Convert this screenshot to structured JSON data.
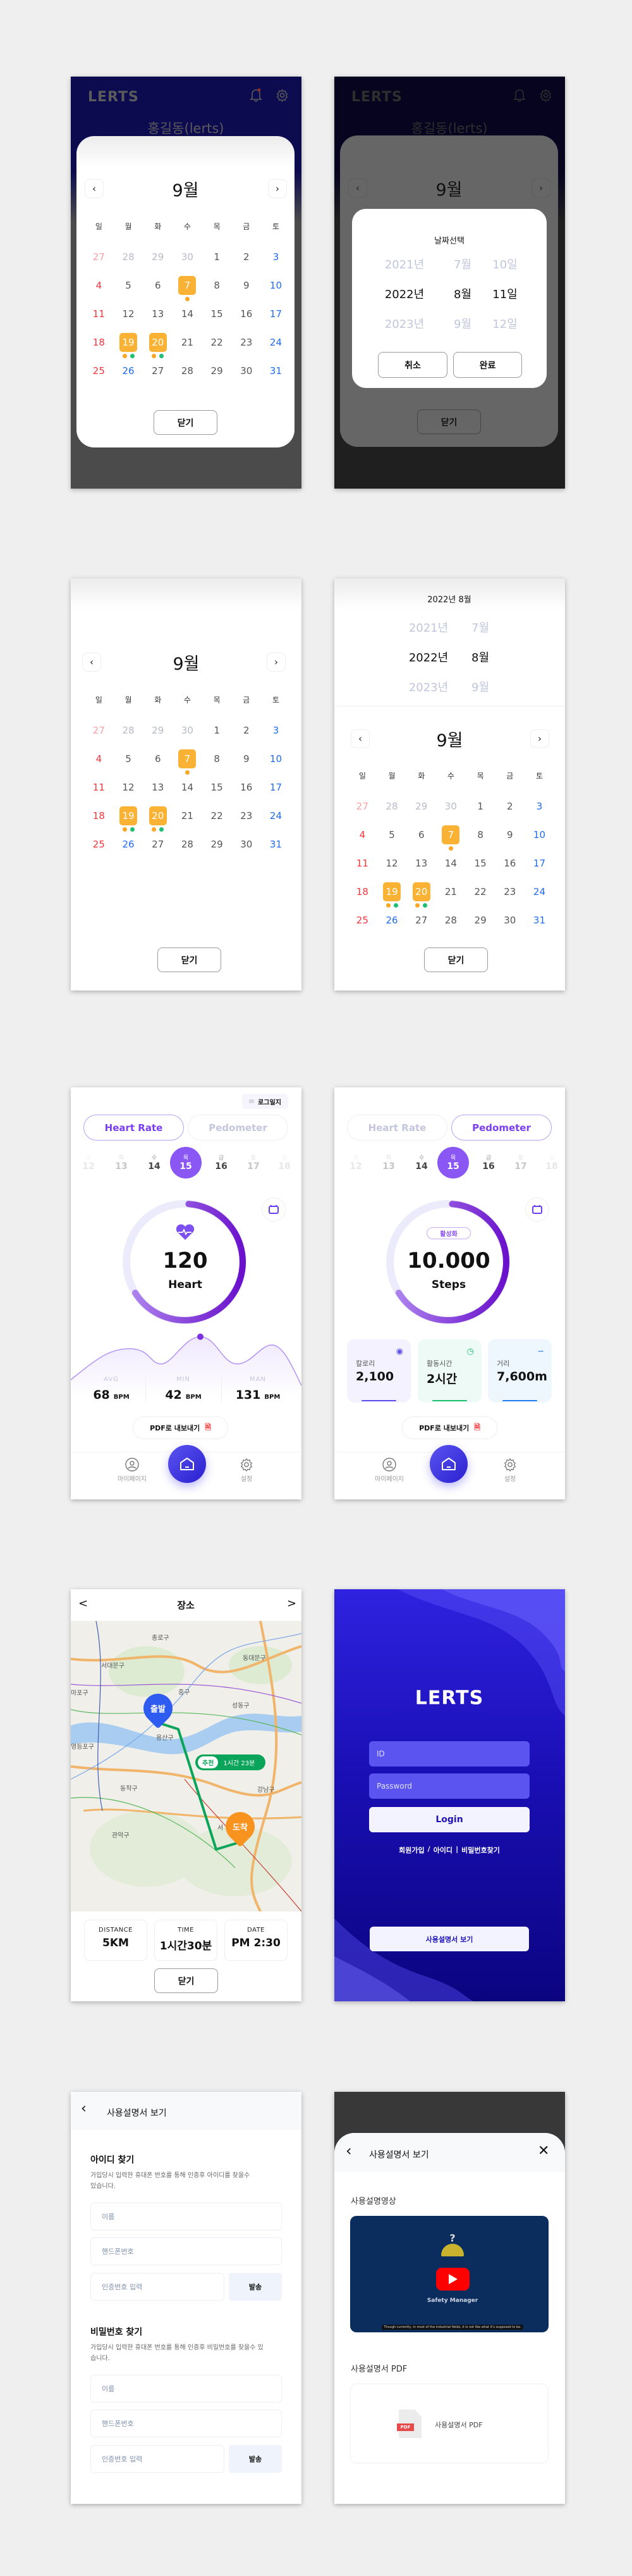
{
  "common": {
    "logo": "LERTS",
    "user_name": "홍길동(lerts)",
    "month_title": "9월",
    "close_label": "닫기",
    "prev_icon": "chevron-left-icon",
    "next_icon": "chevron-right-icon",
    "bell_icon": "bell-icon",
    "gear_icon": "gear-icon"
  },
  "calendar": {
    "weekdays": [
      "일",
      "월",
      "화",
      "수",
      "목",
      "금",
      "토"
    ],
    "weeks": [
      [
        {
          "d": "27",
          "prev": true
        },
        {
          "d": "28",
          "prev": true
        },
        {
          "d": "29",
          "prev": true
        },
        {
          "d": "30",
          "prev": true
        },
        {
          "d": "1"
        },
        {
          "d": "2"
        },
        {
          "d": "3"
        }
      ],
      [
        {
          "d": "4"
        },
        {
          "d": "5"
        },
        {
          "d": "6"
        },
        {
          "d": "7",
          "sel": true,
          "dots": [
            "#f9a825"
          ]
        },
        {
          "d": "8"
        },
        {
          "d": "9"
        },
        {
          "d": "10"
        }
      ],
      [
        {
          "d": "11"
        },
        {
          "d": "12"
        },
        {
          "d": "13"
        },
        {
          "d": "14"
        },
        {
          "d": "15"
        },
        {
          "d": "16"
        },
        {
          "d": "17"
        }
      ],
      [
        {
          "d": "18"
        },
        {
          "d": "19",
          "sel": true,
          "dots": [
            "#f9a825",
            "#1dbf73"
          ]
        },
        {
          "d": "20",
          "sel": true,
          "dots": [
            "#f9a825",
            "#1dbf73"
          ]
        },
        {
          "d": "21"
        },
        {
          "d": "22"
        },
        {
          "d": "23"
        },
        {
          "d": "24"
        }
      ],
      [
        {
          "d": "25"
        },
        {
          "d": "26",
          "blue": true
        },
        {
          "d": "27"
        },
        {
          "d": "28"
        },
        {
          "d": "29"
        },
        {
          "d": "30"
        },
        {
          "d": "31"
        }
      ]
    ],
    "colors": {
      "sunday": "#f2353c",
      "saturday": "#1f6bf0",
      "selected": "#f9b233"
    }
  },
  "date_dialog": {
    "title": "날짜선택",
    "years": [
      "2021년",
      "2022년",
      "2023년"
    ],
    "months": [
      "7월",
      "8월",
      "9월"
    ],
    "days": [
      "10일",
      "11일",
      "12일"
    ],
    "cancel": "취소",
    "confirm": "완료"
  },
  "inline_picker": {
    "title": "2022년 8월",
    "years": [
      "2021년",
      "2022년",
      "2023년"
    ],
    "months": [
      "7월",
      "8월",
      "9월"
    ]
  },
  "dashboard": {
    "log_badge": "로그일지",
    "tabs": [
      "Heart Rate",
      "Pedometer"
    ],
    "days": [
      {
        "w": "월",
        "n": "12"
      },
      {
        "w": "화",
        "n": "13"
      },
      {
        "w": "수",
        "n": "14"
      },
      {
        "w": "목",
        "n": "15"
      },
      {
        "w": "금",
        "n": "16"
      },
      {
        "w": "토",
        "n": "17"
      },
      {
        "w": "일",
        "n": "18"
      }
    ],
    "selected_day": "15",
    "pdf_export": "PDF로 내보내기",
    "nav": {
      "mypage": "마이페이지",
      "settings": "설정"
    },
    "ring_progress": 0.65,
    "accent": "#7b3ff2"
  },
  "heart": {
    "value": "120",
    "unit_label": "Heart",
    "stats": [
      {
        "label": "AVG",
        "value": "68",
        "unit": "BPM"
      },
      {
        "label": "MIN",
        "value": "42",
        "unit": "BPM"
      },
      {
        "label": "MAN",
        "value": "131",
        "unit": "BPM"
      }
    ]
  },
  "pedometer": {
    "status_badge": "활성화",
    "value": "10.000",
    "unit_label": "Steps",
    "cards": [
      {
        "label": "칼로리",
        "value": "2,100",
        "icon": "flame-icon",
        "color": "#5b4ff0",
        "bg": "#f3f2fe"
      },
      {
        "label": "활동시간",
        "value": "2시간",
        "icon": "clock-icon",
        "color": "#1dbf73",
        "bg": "#eefaf5"
      },
      {
        "label": "거리",
        "value": "7,600m",
        "icon": "route-icon",
        "color": "#1f7bf0",
        "bg": "#eef6fe"
      }
    ]
  },
  "place": {
    "title": "장소",
    "start": "출발",
    "end": "도착",
    "recommend_tag": "추천",
    "recommend_time": "1시간 23분",
    "map_labels": [
      "종로구",
      "서대문구",
      "중구",
      "동대문구",
      "성동구",
      "용산구",
      "동작구",
      "강남구",
      "관악구",
      "마포구",
      "영등포구",
      "서"
    ],
    "stats": [
      {
        "label": "DISTANCE",
        "value": "5KM"
      },
      {
        "label": "TIME",
        "value": "1시간30분"
      },
      {
        "label": "DATE",
        "value": "PM 2:30"
      }
    ],
    "close": "닫기"
  },
  "login": {
    "logo": "LERTS",
    "id_placeholder": "ID",
    "password_placeholder": "Password",
    "login_button": "Login",
    "signup": "회원가입",
    "find_id": "아이디",
    "separator": "|",
    "find_pw": "비밀번호찾기",
    "manual_button": "사용설명서 보기"
  },
  "find": {
    "header": "사용설명서 보기",
    "id_title": "아이디 찾기",
    "id_desc": "가입당시 입력한 휴대폰 번호를 통해 인증후 아이디를 찾을수 있습니다.",
    "pw_title": "비밀번호 찾기",
    "pw_desc": "가입당시 입력한 휴대폰 번호를 통해 인증후 비밀번호를 찾을수 있습니다.",
    "name_ph": "이름",
    "phone_ph": "핸드폰번호",
    "code_ph": "인증번호 입력",
    "send": "발송"
  },
  "manual": {
    "header": "사용설명서 보기",
    "video_title": "사용설명영상",
    "video_label": "Safety Manager",
    "video_caption": "Though currently, in most of the industrial fields, it is not like what it's supposed to be.",
    "pdf_title": "사용설명서 PDF",
    "pdf_item": "사용설명서 PDF",
    "pdf_badge": "PDF"
  }
}
